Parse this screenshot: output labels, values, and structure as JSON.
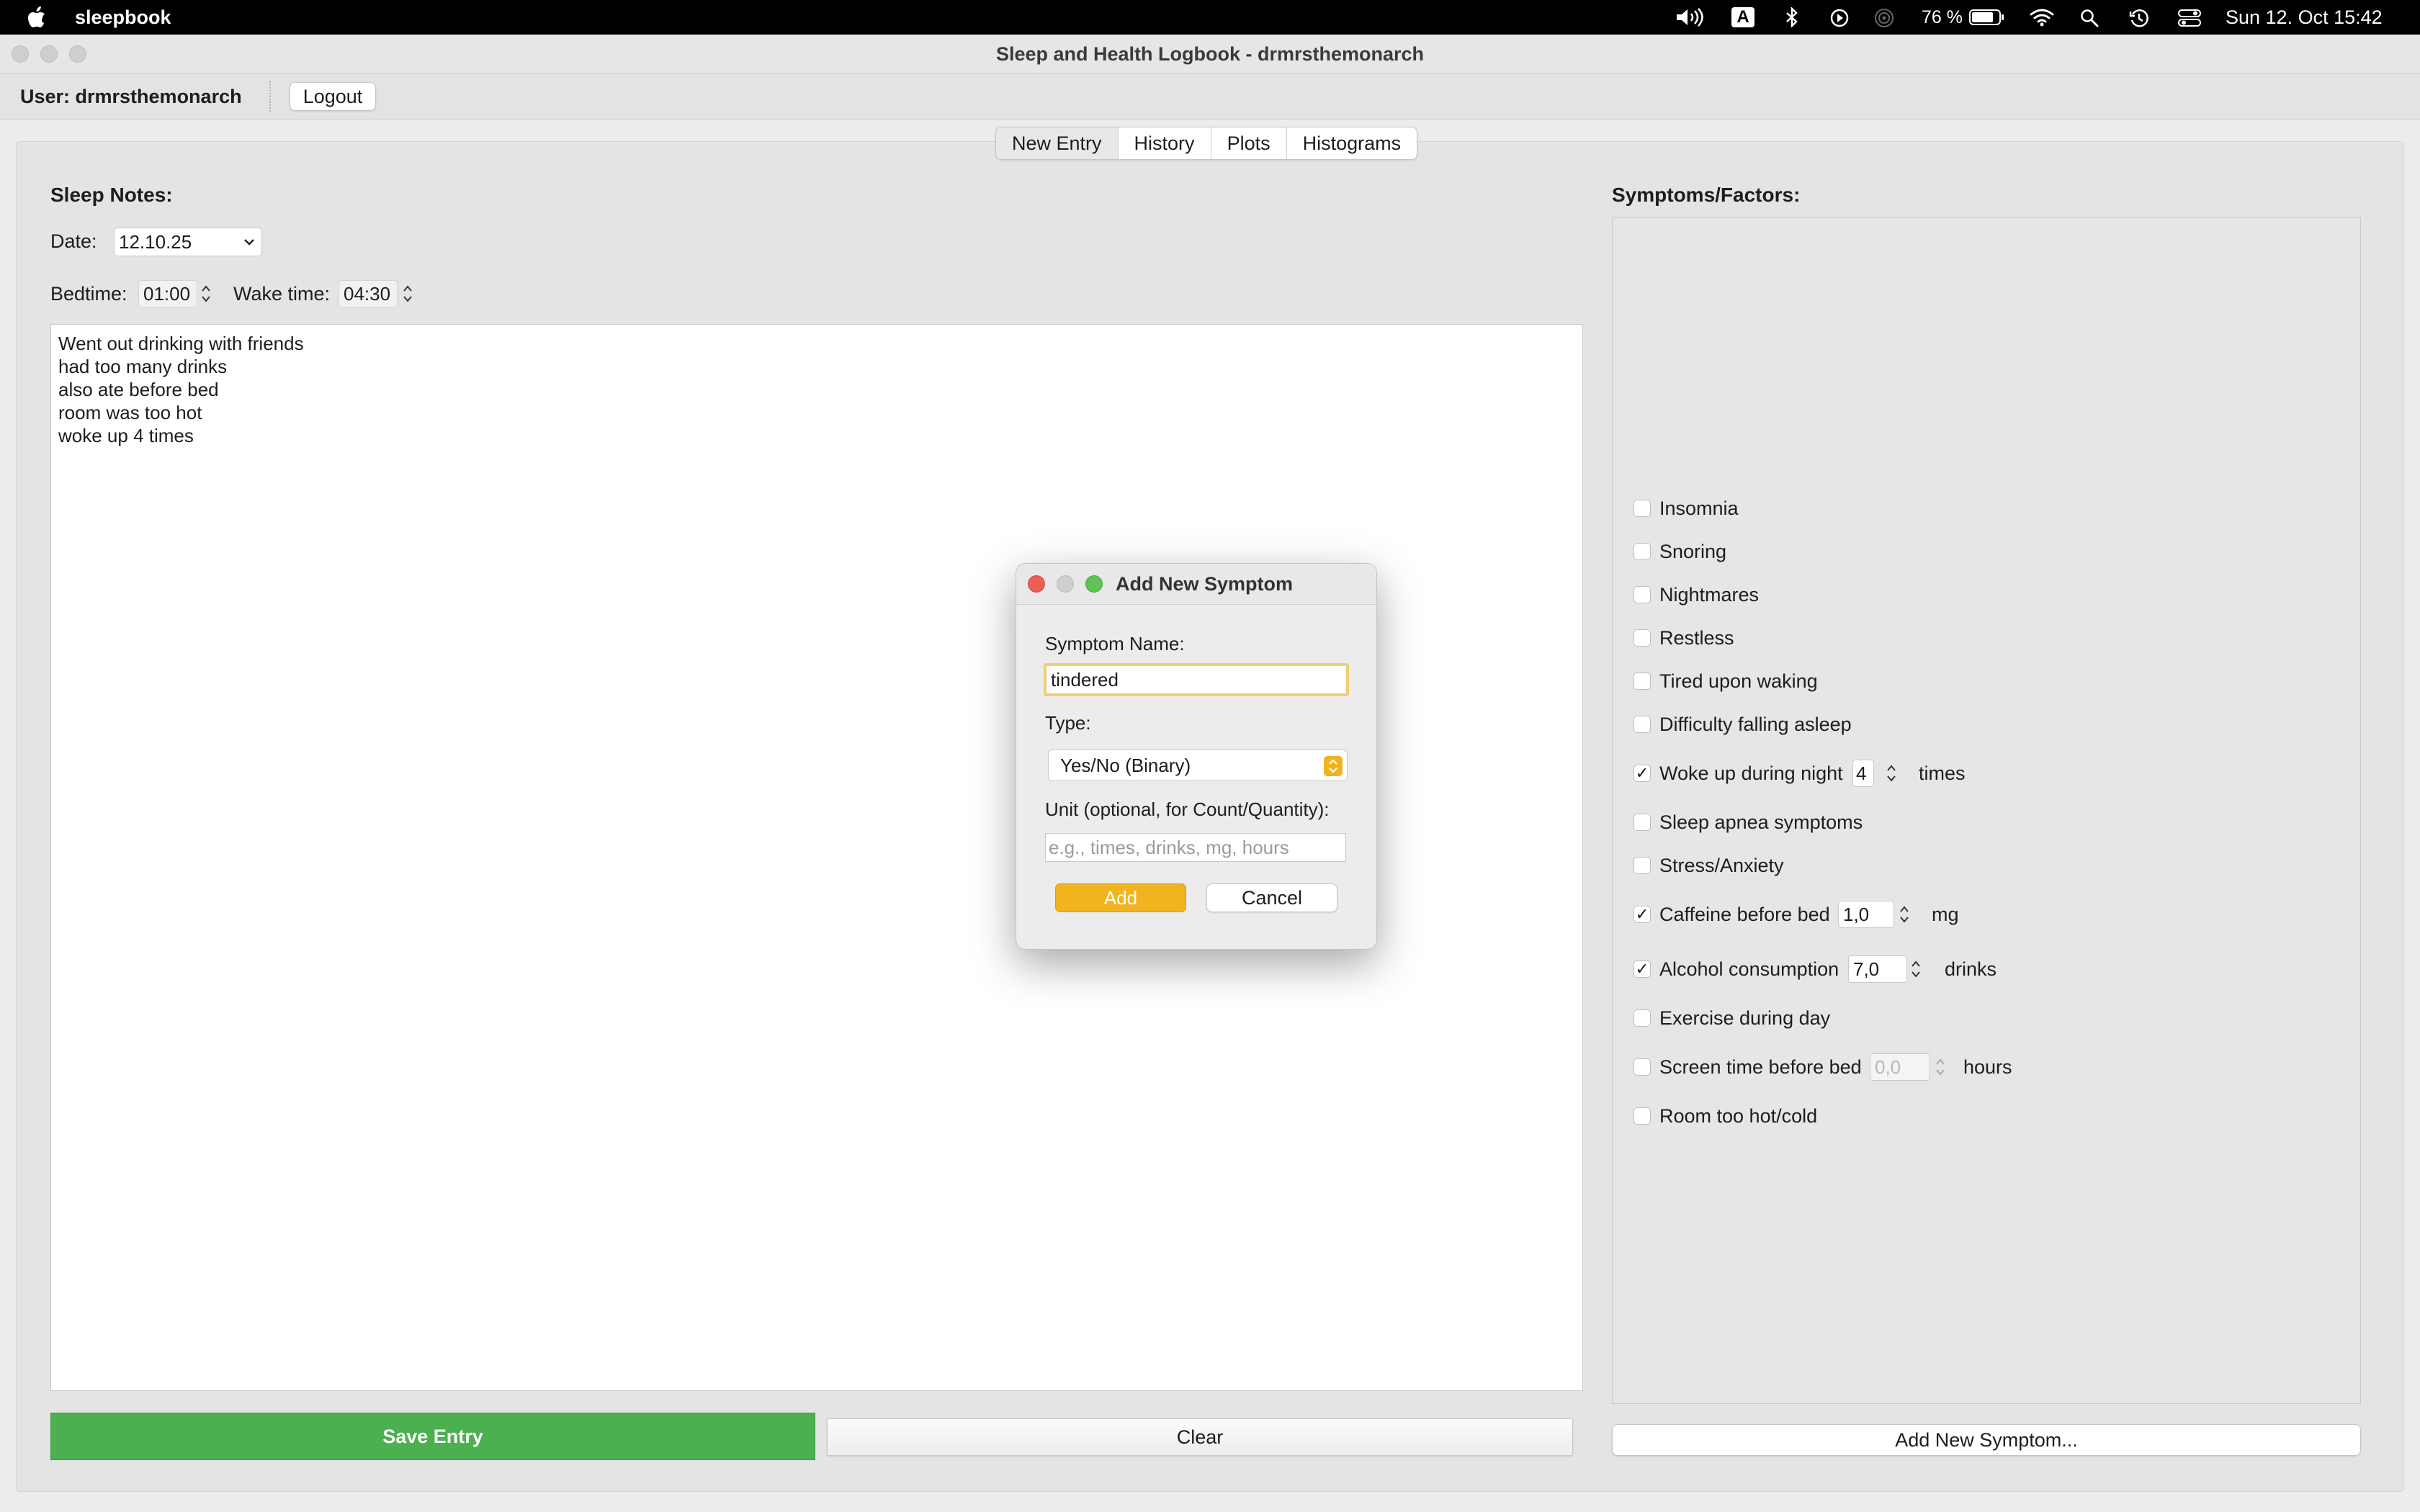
{
  "menubar": {
    "app_name": "sleepbook",
    "input_source": "A",
    "battery_percent": "76 %",
    "datetime": "Sun 12. Oct  15:42"
  },
  "window": {
    "title": "Sleep and Health Logbook - drmrsthemonarch"
  },
  "userbar": {
    "user_label": "User: drmrsthemonarch",
    "logout_label": "Logout"
  },
  "tabs": [
    {
      "label": "New Entry",
      "active": true
    },
    {
      "label": "History"
    },
    {
      "label": "Plots"
    },
    {
      "label": "Histograms"
    }
  ],
  "entry": {
    "section_title": "Sleep Notes:",
    "date_label": "Date:",
    "date_value": "12.10.25",
    "bedtime_label": "Bedtime:",
    "bedtime_value": "01:00",
    "waketime_label": "Wake time:",
    "waketime_value": "04:30",
    "notes": [
      "Went out drinking with friends",
      "had too many drinks",
      "also ate before bed",
      "room was too hot",
      "woke up 4 times"
    ],
    "save_label": "Save Entry",
    "clear_label": "Clear"
  },
  "symptoms": {
    "section_title": "Symptoms/Factors:",
    "items": [
      {
        "label": "Insomnia",
        "checked": false
      },
      {
        "label": "Snoring",
        "checked": false
      },
      {
        "label": "Nightmares",
        "checked": false
      },
      {
        "label": "Restless",
        "checked": false
      },
      {
        "label": "Tired upon waking",
        "checked": false
      },
      {
        "label": "Difficulty falling asleep",
        "checked": false
      },
      {
        "label": "Woke up during night",
        "checked": true,
        "value": "4",
        "unit": "times"
      },
      {
        "label": "Sleep apnea symptoms",
        "checked": false
      },
      {
        "label": "Stress/Anxiety",
        "checked": false
      },
      {
        "label": "Caffeine before bed",
        "checked": true,
        "value": "1,0",
        "unit": "mg"
      },
      {
        "label": "Alcohol consumption",
        "checked": true,
        "value": "7,0",
        "unit": "drinks"
      },
      {
        "label": "Exercise during day",
        "checked": false
      },
      {
        "label": "Screen time before bed",
        "checked": false,
        "value": "0,0",
        "unit": "hours"
      },
      {
        "label": "Room too hot/cold",
        "checked": false
      }
    ],
    "add_label": "Add New Symptom..."
  },
  "dialog": {
    "title": "Add New Symptom",
    "name_label": "Symptom Name:",
    "name_value": "tindered",
    "type_label": "Type:",
    "type_value": "Yes/No (Binary)",
    "unit_label": "Unit (optional, for Count/Quantity):",
    "unit_placeholder": "e.g., times, drinks, mg, hours",
    "add_label": "Add",
    "cancel_label": "Cancel"
  },
  "colors": {
    "save_green": "#4caf50",
    "accent_yellow": "#f1b41f",
    "traffic_red": "#ec5f57",
    "traffic_green": "#5fc454"
  }
}
